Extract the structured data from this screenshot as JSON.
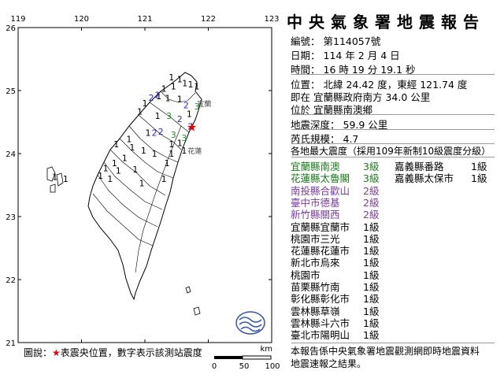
{
  "map": {
    "lon_ticks": [
      "119",
      "120",
      "121",
      "122",
      "123"
    ],
    "lat_ticks": [
      "26",
      "25",
      "24",
      "23",
      "22",
      "21"
    ],
    "city_labels": [
      {
        "name": "宜蘭",
        "lon": 121.75,
        "lat": 24.75
      },
      {
        "name": "花蓮",
        "lon": 121.6,
        "lat": 24.0
      }
    ],
    "epicenter": {
      "lon": 121.74,
      "lat": 24.42
    },
    "stations": [
      {
        "v": "1",
        "lon": 121.42,
        "lat": 25.16,
        "c": "#000000"
      },
      {
        "v": "1",
        "lon": 121.55,
        "lat": 25.13,
        "c": "#000000"
      },
      {
        "v": "1",
        "lon": 121.63,
        "lat": 25.07,
        "c": "#000000"
      },
      {
        "v": "1",
        "lon": 121.45,
        "lat": 25.02,
        "c": "#000000"
      },
      {
        "v": "1",
        "lon": 121.3,
        "lat": 24.98,
        "c": "#000000"
      },
      {
        "v": "1",
        "lon": 121.72,
        "lat": 25.05,
        "c": "#000000"
      },
      {
        "v": "1",
        "lon": 121.82,
        "lat": 25.02,
        "c": "#000000"
      },
      {
        "v": "1",
        "lon": 121.22,
        "lat": 24.86,
        "c": "#000000"
      },
      {
        "v": "1",
        "lon": 121.36,
        "lat": 24.83,
        "c": "#000000"
      },
      {
        "v": "2",
        "lon": 121.1,
        "lat": 24.84,
        "c": "#2b2bd0"
      },
      {
        "v": "2",
        "lon": 121.2,
        "lat": 24.88,
        "c": "#2b2bd0"
      },
      {
        "v": "1",
        "lon": 121.0,
        "lat": 24.75,
        "c": "#000000"
      },
      {
        "v": "1",
        "lon": 121.55,
        "lat": 24.82,
        "c": "#000000"
      },
      {
        "v": "2",
        "lon": 121.65,
        "lat": 24.72,
        "c": "#2b2bd0"
      },
      {
        "v": "3",
        "lon": 121.82,
        "lat": 24.7,
        "c": "#1a9a1a"
      },
      {
        "v": "1",
        "lon": 121.7,
        "lat": 24.58,
        "c": "#000000"
      },
      {
        "v": "3",
        "lon": 121.38,
        "lat": 24.55,
        "c": "#1a9a1a"
      },
      {
        "v": "1",
        "lon": 121.2,
        "lat": 24.55,
        "c": "#000000"
      },
      {
        "v": "1",
        "lon": 120.92,
        "lat": 24.62,
        "c": "#000000"
      },
      {
        "v": "2",
        "lon": 121.55,
        "lat": 24.5,
        "c": "#2b2bd0"
      },
      {
        "v": "2",
        "lon": 121.72,
        "lat": 24.38,
        "c": "#2b2bd0"
      },
      {
        "v": "2",
        "lon": 121.25,
        "lat": 24.3,
        "c": "#2b2bd0"
      },
      {
        "v": "2",
        "lon": 121.15,
        "lat": 24.28,
        "c": "#2b2bd0"
      },
      {
        "v": "1",
        "lon": 121.05,
        "lat": 24.28,
        "c": "#000000"
      },
      {
        "v": "3",
        "lon": 121.45,
        "lat": 24.25,
        "c": "#1a9a1a"
      },
      {
        "v": "3",
        "lon": 121.62,
        "lat": 24.2,
        "c": "#1a9a1a"
      },
      {
        "v": "1",
        "lon": 120.75,
        "lat": 24.18,
        "c": "#000000"
      },
      {
        "v": "1",
        "lon": 120.55,
        "lat": 24.1,
        "c": "#000000"
      },
      {
        "v": "1",
        "lon": 121.42,
        "lat": 24.1,
        "c": "#000000"
      },
      {
        "v": "1",
        "lon": 121.55,
        "lat": 24.12,
        "c": "#000000"
      },
      {
        "v": "1",
        "lon": 121.62,
        "lat": 24.0,
        "c": "#000000"
      },
      {
        "v": "1",
        "lon": 121.42,
        "lat": 23.95,
        "c": "#000000"
      },
      {
        "v": "1",
        "lon": 121.15,
        "lat": 23.95,
        "c": "#000000"
      },
      {
        "v": "1",
        "lon": 120.98,
        "lat": 24.0,
        "c": "#000000"
      },
      {
        "v": "1",
        "lon": 120.8,
        "lat": 24.05,
        "c": "#000000"
      },
      {
        "v": "1",
        "lon": 120.68,
        "lat": 23.88,
        "c": "#000000"
      },
      {
        "v": "1",
        "lon": 120.52,
        "lat": 23.8,
        "c": "#000000"
      },
      {
        "v": "1",
        "lon": 120.38,
        "lat": 23.72,
        "c": "#000000"
      },
      {
        "v": "1",
        "lon": 120.58,
        "lat": 23.68,
        "c": "#000000"
      },
      {
        "v": "1",
        "lon": 120.3,
        "lat": 23.6,
        "c": "#000000"
      },
      {
        "v": "1",
        "lon": 120.45,
        "lat": 23.55,
        "c": "#000000"
      },
      {
        "v": "1",
        "lon": 120.85,
        "lat": 23.7,
        "c": "#000000"
      },
      {
        "v": "1",
        "lon": 121.35,
        "lat": 23.8,
        "c": "#000000"
      },
      {
        "v": "1",
        "lon": 121.3,
        "lat": 23.55,
        "c": "#000000"
      },
      {
        "v": "1",
        "lon": 120.95,
        "lat": 23.48,
        "c": "#000000"
      },
      {
        "v": "1",
        "lon": 119.58,
        "lat": 23.58,
        "c": "#000000"
      },
      {
        "v": "1",
        "lon": 119.75,
        "lat": 23.55,
        "c": "#000000"
      }
    ],
    "scale": {
      "labels": [
        "0",
        "50",
        "100"
      ],
      "unit": "km"
    }
  },
  "legend": {
    "prefix": "圖說：",
    "star": "★",
    "text": "表震央位置，數字表示該測站震度"
  },
  "report": {
    "title": "中央氣象署地震報告",
    "number_label": "編號：",
    "number": "第114057號",
    "date_label": "日期：",
    "date": "114 年 2 月 4 日",
    "time_label": "時間：",
    "time": "16 時 19 分 19.1 秒",
    "location_label": "位置：",
    "location": "北緯 24.42 度，東經 121.74 度",
    "location_ref_prefix": "即在",
    "location_ref": "宜蘭縣政府南方 34.0 公里",
    "location_area_prefix": "位於",
    "location_area": "宜蘭縣南澳鄉",
    "depth_label": "地震深度：",
    "depth": "59.9 公里",
    "magnitude_label": "芮氏規模：",
    "magnitude": "4.7",
    "intensity_header": "各地最大震度（採用109年新制10級震度分級）",
    "intensities": [
      {
        "name": "宜蘭縣南澳",
        "value": "3級",
        "color": "#1a7a1a"
      },
      {
        "name": "花蓮縣太魯閣",
        "value": "3級",
        "color": "#1a7a1a"
      },
      {
        "name": "南投縣合歡山",
        "value": "2級",
        "color": "#7a3aa0"
      },
      {
        "name": "臺中市德基",
        "value": "2級",
        "color": "#7a3aa0"
      },
      {
        "name": "新竹縣關西",
        "value": "2級",
        "color": "#7a3aa0"
      },
      {
        "name": "宜蘭縣宜蘭市",
        "value": "1級",
        "color": "#000000"
      },
      {
        "name": "桃園市三光",
        "value": "1級",
        "color": "#000000"
      },
      {
        "name": "花蓮縣花蓮市",
        "value": "1級",
        "color": "#000000"
      },
      {
        "name": "新北市烏來",
        "value": "1級",
        "color": "#000000"
      },
      {
        "name": "桃園市",
        "value": "1級",
        "color": "#000000"
      },
      {
        "name": "苗栗縣竹南",
        "value": "1級",
        "color": "#000000"
      },
      {
        "name": "彰化縣彰化市",
        "value": "1級",
        "color": "#000000"
      },
      {
        "name": "雲林縣草嶺",
        "value": "1級",
        "color": "#000000"
      },
      {
        "name": "雲林縣斗六市",
        "value": "1級",
        "color": "#000000"
      },
      {
        "name": "臺北市陽明山",
        "value": "1級",
        "color": "#000000"
      }
    ],
    "intensities_col2": [
      {
        "name": "嘉義縣番路",
        "value": "1級"
      },
      {
        "name": "嘉義縣太保市",
        "value": "1級"
      }
    ],
    "footnote_1": "本報告係中央氣象署地震觀測網即時地震資料",
    "footnote_2": "地震速報之結果。"
  }
}
